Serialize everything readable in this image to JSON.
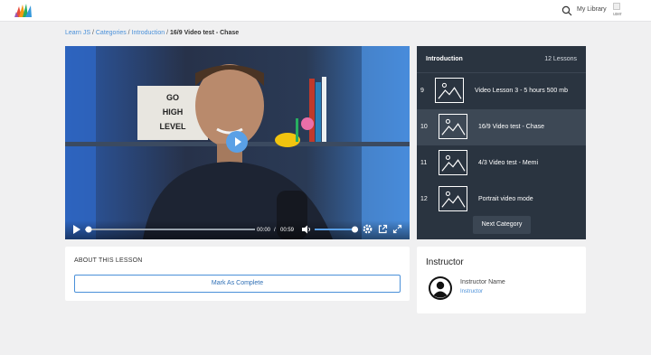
{
  "header": {
    "logo_icon": "multicolor-fan-logo-icon",
    "search_icon": "search-icon",
    "my_library_label": "My Library",
    "avatar_alt": "user"
  },
  "breadcrumb": {
    "items": [
      "Learn JS",
      "Categories",
      "Introduction"
    ],
    "separator": " / ",
    "current": "16/9 Video test - Chase"
  },
  "player": {
    "play_icon": "play-icon",
    "current_time": "00:00",
    "time_separator": "/",
    "duration": "00:59",
    "progress": 0.0,
    "volume": 0.95,
    "volume_icon": "volume-icon",
    "settings_icon": "gear-icon",
    "popout_icon": "popout-icon",
    "fullscreen_icon": "fullscreen-icon",
    "accent_color": "#5aa0e6",
    "sign_text": [
      "GO",
      "HIGH",
      "LEVEL"
    ]
  },
  "playlist": {
    "title": "Introduction",
    "count": "12 Lessons",
    "items": [
      {
        "num": "9",
        "label": "Video Lesson 3 - 5 hours 500 mb",
        "active": false
      },
      {
        "num": "10",
        "label": "16/9 Video test - Chase",
        "active": true
      },
      {
        "num": "11",
        "label": "4/3 Video test - Memi",
        "active": false
      },
      {
        "num": "12",
        "label": "Portrait video mode",
        "active": false
      }
    ],
    "next_button": "Next Category",
    "background_color": "#2a3440"
  },
  "about": {
    "title": "ABOUT THIS LESSON",
    "mark_complete": "Mark As Complete"
  },
  "instructor": {
    "title": "Instructor",
    "name": "Instructor Name",
    "role": "Instructor",
    "avatar_icon": "user-avatar-icon"
  }
}
